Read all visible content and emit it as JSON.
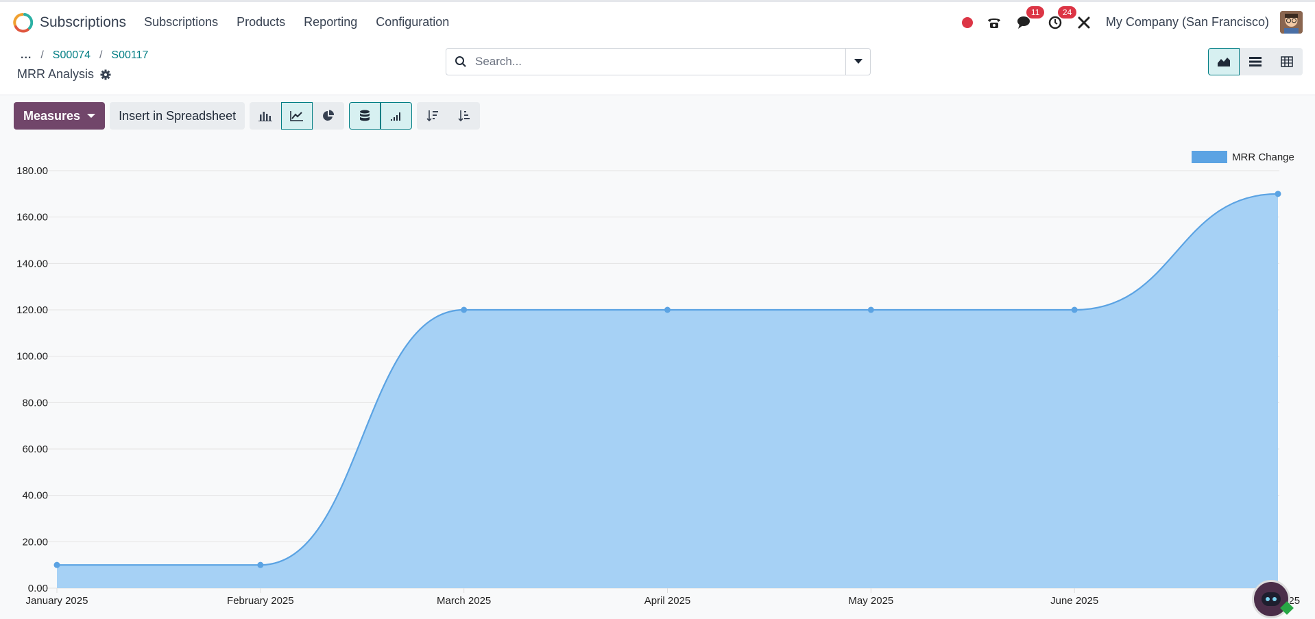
{
  "navbar": {
    "app_name": "Subscriptions",
    "menu": [
      "Subscriptions",
      "Products",
      "Reporting",
      "Configuration"
    ],
    "messages_badge": "11",
    "activities_badge": "24",
    "company": "My Company (San Francisco)"
  },
  "breadcrumb": {
    "dots": "...",
    "items": [
      "S00074",
      "S00117"
    ]
  },
  "page": {
    "title": "MRR Analysis"
  },
  "search": {
    "placeholder": "Search..."
  },
  "toolbar": {
    "measures_label": "Measures",
    "spreadsheet_label": "Insert in Spreadsheet"
  },
  "colors": {
    "accent": "#71466a",
    "teal": "#017e84",
    "series_line": "#5ba3e3",
    "series_fill": "#a6d1f5"
  },
  "chart_data": {
    "type": "area",
    "categories": [
      "January 2025",
      "February 2025",
      "March 2025",
      "April 2025",
      "May 2025",
      "June 2025",
      "July 2025"
    ],
    "series": [
      {
        "name": "MRR Change",
        "values": [
          10,
          10,
          120,
          120,
          120,
          120,
          170
        ]
      }
    ],
    "ylim": [
      0,
      180
    ],
    "yticks": [
      "0.00",
      "20.00",
      "40.00",
      "60.00",
      "80.00",
      "100.00",
      "120.00",
      "140.00",
      "160.00",
      "180.00"
    ],
    "grid": true,
    "legend_position": "top-right"
  }
}
